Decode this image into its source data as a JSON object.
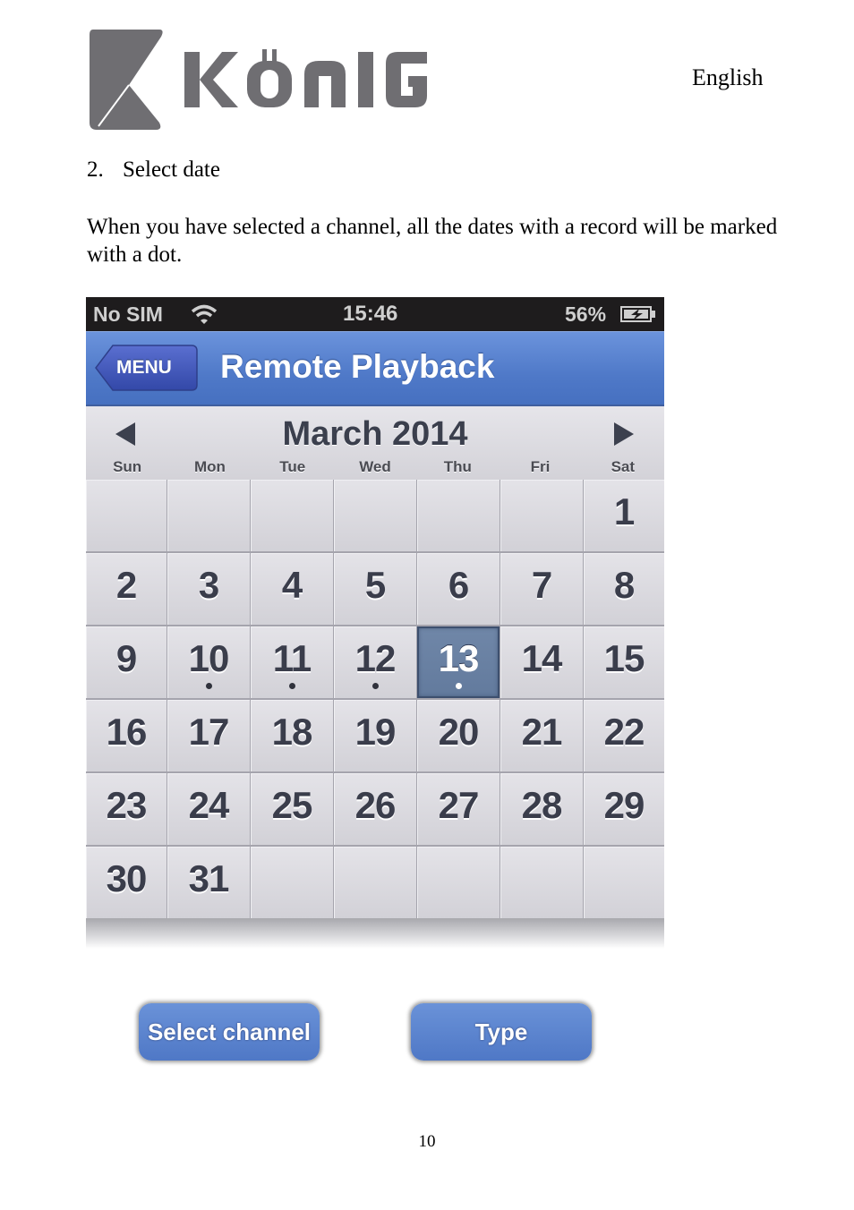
{
  "header": {
    "brand": "KÖNIG",
    "language": "English"
  },
  "section": {
    "step_number": "2.",
    "step_title": "Select date",
    "description": "When you have selected a channel, all the dates with a record will be marked with a dot."
  },
  "app": {
    "status_bar": {
      "carrier": "No SIM",
      "wifi_icon": "wifi-icon",
      "time": "15:46",
      "battery_percent": "56%",
      "battery_icon": "battery-charging-icon"
    },
    "nav_bar": {
      "back_label": "MENU",
      "title": "Remote Playback"
    },
    "calendar": {
      "month_title": "March 2014",
      "prev_icon": "triangle-left-icon",
      "next_icon": "triangle-right-icon",
      "weekdays": [
        "Sun",
        "Mon",
        "Tue",
        "Wed",
        "Thu",
        "Fri",
        "Sat"
      ],
      "cells": [
        "",
        "",
        "",
        "",
        "",
        "",
        "1",
        "2",
        "3",
        "4",
        "5",
        "6",
        "7",
        "8",
        "9",
        "10",
        "11",
        "12",
        "13",
        "14",
        "15",
        "16",
        "17",
        "18",
        "19",
        "20",
        "21",
        "22",
        "23",
        "24",
        "25",
        "26",
        "27",
        "28",
        "29",
        "30",
        "31",
        "",
        "",
        "",
        "",
        ""
      ],
      "days_with_records": [
        10,
        11,
        12,
        13
      ],
      "selected_day": 13
    },
    "buttons": {
      "select_channel": "Select channel",
      "type": "Type"
    }
  },
  "footer": {
    "page_number": "10"
  }
}
